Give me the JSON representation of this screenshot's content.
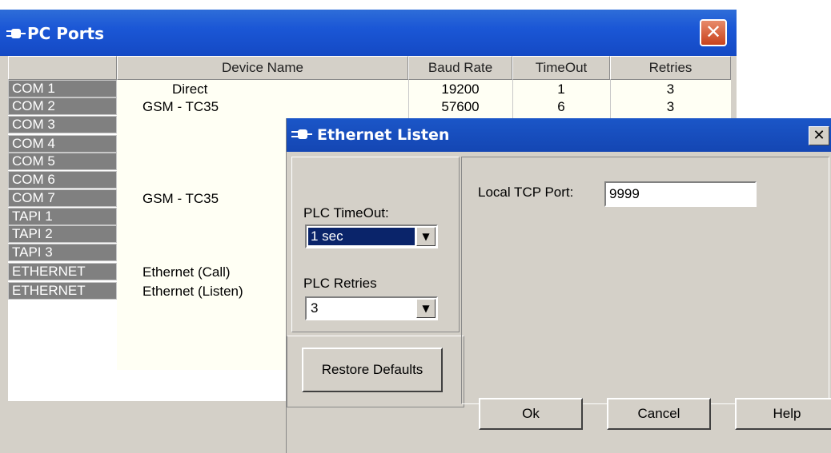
{
  "pc_ports": {
    "title": "PC Ports",
    "columns": [
      "Device Name",
      "Baud Rate",
      "TimeOut",
      "Retries"
    ],
    "rows": [
      {
        "port": "COM 1",
        "device": "Direct",
        "baud": "19200",
        "timeout": "1",
        "retries": "3"
      },
      {
        "port": "COM 2",
        "device": "GSM - TC35",
        "baud": "57600",
        "timeout": "6",
        "retries": "3"
      },
      {
        "port": "COM 3",
        "device": "",
        "baud": "",
        "timeout": "",
        "retries": ""
      },
      {
        "port": "COM 4",
        "device": "",
        "baud": "",
        "timeout": "",
        "retries": ""
      },
      {
        "port": "COM 5",
        "device": "",
        "baud": "",
        "timeout": "",
        "retries": ""
      },
      {
        "port": "COM 6",
        "device": "",
        "baud": "",
        "timeout": "",
        "retries": ""
      },
      {
        "port": "COM 7",
        "device": "GSM - TC35",
        "baud": "",
        "timeout": "",
        "retries": ""
      },
      {
        "port": "TAPI 1",
        "device": "",
        "baud": "",
        "timeout": "",
        "retries": ""
      },
      {
        "port": "TAPI 2",
        "device": "",
        "baud": "",
        "timeout": "",
        "retries": ""
      },
      {
        "port": "TAPI 3",
        "device": "",
        "baud": "",
        "timeout": "",
        "retries": ""
      },
      {
        "port": "ETHERNET",
        "device": "Ethernet (Call)",
        "baud": "",
        "timeout": "",
        "retries": ""
      },
      {
        "port": "ETHERNET",
        "device": "Ethernet (Listen)",
        "baud": "",
        "timeout": "",
        "retries": ""
      }
    ]
  },
  "ethernet_listen": {
    "title": "Ethernet Listen",
    "plc_timeout_label": "PLC TimeOut:",
    "plc_timeout_value": "1 sec",
    "plc_retries_label": "PLC Retries",
    "plc_retries_value": "3",
    "restore_defaults_label": "Restore Defaults",
    "local_tcp_port_label": "Local TCP Port:",
    "local_tcp_port_value": "9999",
    "ok_label": "Ok",
    "cancel_label": "Cancel",
    "help_label": "Help"
  },
  "colors": {
    "title_bar": "#1b57d6",
    "close_button": "#d9532b",
    "grid_header": "#d4d0c8",
    "port_label": "#808080",
    "selection": "#0a246a"
  }
}
